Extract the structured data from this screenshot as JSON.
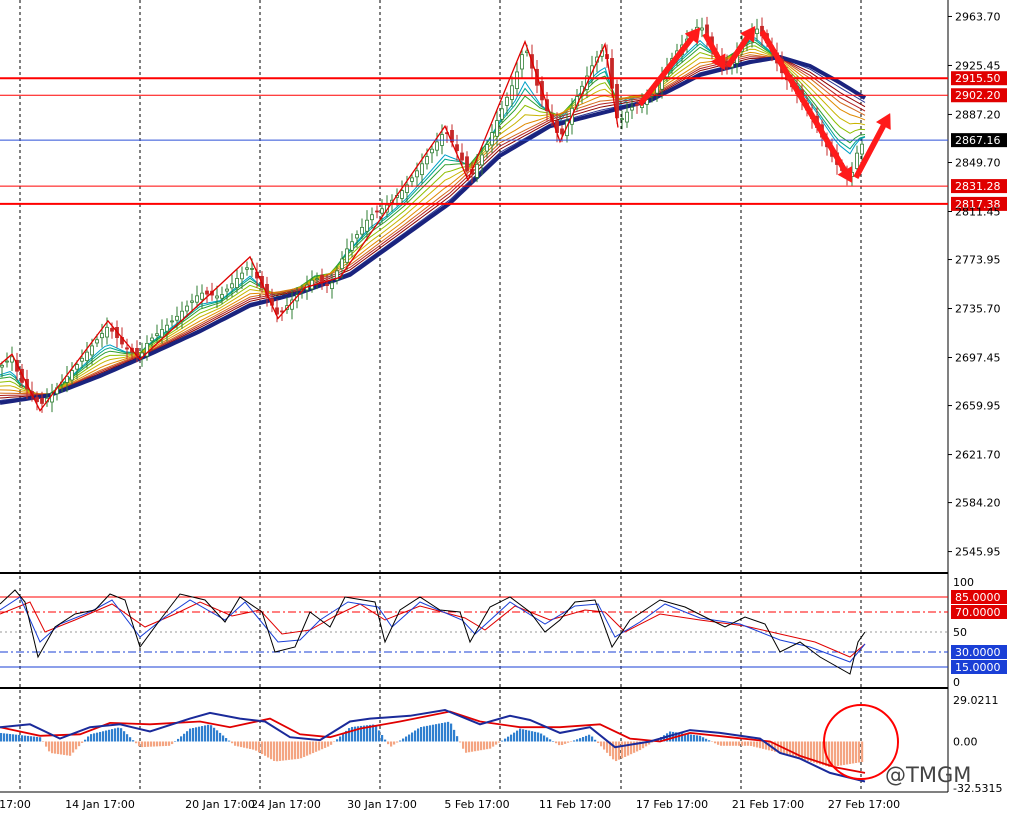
{
  "chart_data": {
    "type": "line",
    "main": {
      "y_ticks": [
        "2963.70",
        "2925.45",
        "2887.20",
        "2849.70",
        "2811.45",
        "2773.95",
        "2735.70",
        "2697.45",
        "2659.95",
        "2621.70",
        "2584.20",
        "2545.95"
      ],
      "ylim": [
        2530,
        2975
      ],
      "price_path": [
        [
          0,
          2690
        ],
        [
          12,
          2698
        ],
        [
          20,
          2680
        ],
        [
          40,
          2660
        ],
        [
          55,
          2672
        ],
        [
          75,
          2690
        ],
        [
          108,
          2722
        ],
        [
          125,
          2705
        ],
        [
          140,
          2698
        ],
        [
          148,
          2710
        ],
        [
          175,
          2728
        ],
        [
          200,
          2748
        ],
        [
          220,
          2745
        ],
        [
          250,
          2770
        ],
        [
          262,
          2752
        ],
        [
          278,
          2730
        ],
        [
          295,
          2745
        ],
        [
          315,
          2760
        ],
        [
          330,
          2752
        ],
        [
          345,
          2780
        ],
        [
          370,
          2808
        ],
        [
          385,
          2815
        ],
        [
          405,
          2830
        ],
        [
          425,
          2852
        ],
        [
          445,
          2875
        ],
        [
          460,
          2855
        ],
        [
          470,
          2838
        ],
        [
          485,
          2860
        ],
        [
          500,
          2888
        ],
        [
          515,
          2915
        ],
        [
          525,
          2942
        ],
        [
          540,
          2902
        ],
        [
          560,
          2868
        ],
        [
          575,
          2898
        ],
        [
          595,
          2930
        ],
        [
          605,
          2940
        ],
        [
          618,
          2880
        ],
        [
          630,
          2892
        ],
        [
          650,
          2900
        ],
        [
          675,
          2935
        ],
        [
          700,
          2958
        ],
        [
          712,
          2938
        ],
        [
          725,
          2922
        ],
        [
          745,
          2945
        ],
        [
          755,
          2956
        ],
        [
          770,
          2940
        ],
        [
          780,
          2922
        ],
        [
          800,
          2900
        ],
        [
          815,
          2880
        ],
        [
          835,
          2850
        ],
        [
          850,
          2836
        ],
        [
          858,
          2860
        ],
        [
          865,
          2867
        ]
      ],
      "ma_slow": [
        [
          0,
          2662
        ],
        [
          50,
          2668
        ],
        [
          100,
          2683
        ],
        [
          150,
          2700
        ],
        [
          200,
          2718
        ],
        [
          250,
          2738
        ],
        [
          300,
          2748
        ],
        [
          350,
          2762
        ],
        [
          400,
          2790
        ],
        [
          450,
          2818
        ],
        [
          500,
          2855
        ],
        [
          550,
          2878
        ],
        [
          600,
          2888
        ],
        [
          650,
          2898
        ],
        [
          700,
          2918
        ],
        [
          750,
          2928
        ],
        [
          780,
          2932
        ],
        [
          810,
          2925
        ],
        [
          840,
          2912
        ],
        [
          865,
          2900
        ]
      ],
      "ma_fast": [
        [
          0,
          2678
        ],
        [
          50,
          2670
        ],
        [
          100,
          2692
        ],
        [
          150,
          2706
        ],
        [
          200,
          2730
        ],
        [
          250,
          2752
        ],
        [
          300,
          2755
        ],
        [
          350,
          2778
        ],
        [
          400,
          2808
        ],
        [
          450,
          2840
        ],
        [
          500,
          2876
        ],
        [
          550,
          2892
        ],
        [
          600,
          2908
        ],
        [
          650,
          2905
        ],
        [
          700,
          2932
        ],
        [
          750,
          2940
        ],
        [
          780,
          2930
        ],
        [
          810,
          2905
        ],
        [
          840,
          2880
        ],
        [
          865,
          2872
        ]
      ],
      "zigzag": [
        [
          0,
          2692
        ],
        [
          12,
          2700
        ],
        [
          40,
          2656
        ],
        [
          108,
          2726
        ],
        [
          140,
          2696
        ],
        [
          250,
          2776
        ],
        [
          278,
          2728
        ],
        [
          305,
          2752
        ],
        [
          340,
          2760
        ],
        [
          445,
          2878
        ],
        [
          468,
          2836
        ],
        [
          525,
          2944
        ],
        [
          560,
          2866
        ],
        [
          605,
          2942
        ],
        [
          618,
          2877
        ]
      ],
      "arrows": [
        [
          [
            640,
            2895
          ],
          [
            700,
            2955
          ]
        ],
        [
          [
            705,
            2950
          ],
          [
            725,
            2922
          ]
        ],
        [
          [
            728,
            2925
          ],
          [
            755,
            2956
          ]
        ],
        [
          [
            762,
            2952
          ],
          [
            852,
            2834
          ]
        ],
        [
          [
            856,
            2838
          ],
          [
            890,
            2888
          ]
        ]
      ],
      "levels": [
        {
          "label": "2915.50",
          "value": 2915.5,
          "color": "#ff0000",
          "thick": true
        },
        {
          "label": "2902.20",
          "value": 2902.2,
          "color": "#ff0000",
          "thick": false
        },
        {
          "label": "2867.16",
          "value": 2867.16,
          "color": "#2b4fd6",
          "thick": false,
          "current": true
        },
        {
          "label": "2831.28",
          "value": 2831.28,
          "color": "#ff0000",
          "thick": false
        },
        {
          "label": "2817.38",
          "value": 2817.38,
          "color": "#ff0000",
          "thick": true
        }
      ]
    },
    "stoch": {
      "ylim": [
        0,
        100
      ],
      "y_ticks": [
        "100",
        "50",
        "0"
      ],
      "levels": [
        {
          "label": "85.0000",
          "value": 85,
          "color": "#ff0000",
          "style": "solid"
        },
        {
          "label": "70.0000",
          "value": 70,
          "color": "#ff0000",
          "style": "dashdot"
        },
        {
          "label": "30.0000",
          "value": 30,
          "color": "#1a3fd6",
          "style": "dashdot"
        },
        {
          "label": "15.0000",
          "value": 15,
          "color": "#1a3fd6",
          "style": "solid"
        }
      ],
      "black": [
        [
          0,
          78
        ],
        [
          15,
          92
        ],
        [
          25,
          80
        ],
        [
          38,
          25
        ],
        [
          55,
          55
        ],
        [
          75,
          68
        ],
        [
          95,
          72
        ],
        [
          110,
          88
        ],
        [
          125,
          82
        ],
        [
          140,
          35
        ],
        [
          160,
          62
        ],
        [
          180,
          88
        ],
        [
          205,
          82
        ],
        [
          225,
          60
        ],
        [
          240,
          85
        ],
        [
          262,
          70
        ],
        [
          275,
          30
        ],
        [
          295,
          35
        ],
        [
          310,
          70
        ],
        [
          330,
          55
        ],
        [
          345,
          85
        ],
        [
          375,
          80
        ],
        [
          385,
          40
        ],
        [
          400,
          72
        ],
        [
          420,
          85
        ],
        [
          440,
          72
        ],
        [
          460,
          70
        ],
        [
          470,
          40
        ],
        [
          490,
          75
        ],
        [
          510,
          85
        ],
        [
          530,
          70
        ],
        [
          545,
          50
        ],
        [
          560,
          62
        ],
        [
          575,
          80
        ],
        [
          595,
          82
        ],
        [
          612,
          35
        ],
        [
          630,
          62
        ],
        [
          660,
          82
        ],
        [
          685,
          75
        ],
        [
          705,
          65
        ],
        [
          725,
          55
        ],
        [
          745,
          65
        ],
        [
          765,
          58
        ],
        [
          780,
          30
        ],
        [
          800,
          40
        ],
        [
          820,
          25
        ],
        [
          850,
          8
        ],
        [
          858,
          40
        ],
        [
          865,
          50
        ]
      ],
      "blue": [
        [
          0,
          72
        ],
        [
          20,
          85
        ],
        [
          40,
          40
        ],
        [
          60,
          58
        ],
        [
          90,
          70
        ],
        [
          112,
          82
        ],
        [
          140,
          45
        ],
        [
          165,
          65
        ],
        [
          190,
          82
        ],
        [
          225,
          62
        ],
        [
          245,
          80
        ],
        [
          278,
          40
        ],
        [
          300,
          42
        ],
        [
          320,
          62
        ],
        [
          348,
          80
        ],
        [
          378,
          75
        ],
        [
          392,
          55
        ],
        [
          420,
          80
        ],
        [
          462,
          62
        ],
        [
          475,
          48
        ],
        [
          510,
          80
        ],
        [
          545,
          58
        ],
        [
          575,
          76
        ],
        [
          598,
          78
        ],
        [
          615,
          45
        ],
        [
          640,
          60
        ],
        [
          665,
          78
        ],
        [
          700,
          64
        ],
        [
          740,
          58
        ],
        [
          780,
          42
        ],
        [
          810,
          35
        ],
        [
          850,
          20
        ],
        [
          865,
          38
        ]
      ],
      "red": [
        [
          0,
          68
        ],
        [
          30,
          80
        ],
        [
          45,
          50
        ],
        [
          75,
          62
        ],
        [
          112,
          78
        ],
        [
          145,
          55
        ],
        [
          175,
          68
        ],
        [
          200,
          80
        ],
        [
          232,
          66
        ],
        [
          260,
          72
        ],
        [
          282,
          48
        ],
        [
          310,
          52
        ],
        [
          335,
          66
        ],
        [
          360,
          78
        ],
        [
          385,
          62
        ],
        [
          420,
          76
        ],
        [
          465,
          64
        ],
        [
          485,
          52
        ],
        [
          515,
          76
        ],
        [
          550,
          62
        ],
        [
          585,
          72
        ],
        [
          605,
          70
        ],
        [
          625,
          50
        ],
        [
          660,
          68
        ],
        [
          700,
          62
        ],
        [
          745,
          56
        ],
        [
          780,
          48
        ],
        [
          815,
          40
        ],
        [
          850,
          25
        ],
        [
          865,
          38
        ]
      ]
    },
    "macd": {
      "ylim": [
        -32.5315,
        29.0211
      ],
      "y_ticks": [
        "29.0211",
        "0.00",
        "-32.5315"
      ],
      "hist": [
        [
          0,
          6
        ],
        [
          40,
          3
        ],
        [
          50,
          -8
        ],
        [
          70,
          -10
        ],
        [
          90,
          5
        ],
        [
          120,
          10
        ],
        [
          140,
          -4
        ],
        [
          170,
          -3
        ],
        [
          190,
          9
        ],
        [
          210,
          12
        ],
        [
          235,
          -3
        ],
        [
          255,
          -6
        ],
        [
          275,
          -14
        ],
        [
          300,
          -12
        ],
        [
          330,
          -3
        ],
        [
          350,
          10
        ],
        [
          375,
          12
        ],
        [
          390,
          -4
        ],
        [
          420,
          10
        ],
        [
          450,
          14
        ],
        [
          465,
          -8
        ],
        [
          490,
          -5
        ],
        [
          520,
          9
        ],
        [
          540,
          6
        ],
        [
          560,
          -3
        ],
        [
          590,
          5
        ],
        [
          615,
          -14
        ],
        [
          640,
          -6
        ],
        [
          670,
          7
        ],
        [
          700,
          4
        ],
        [
          720,
          -3
        ],
        [
          750,
          -3
        ],
        [
          780,
          -8
        ],
        [
          800,
          -12
        ],
        [
          830,
          -18
        ],
        [
          865,
          -14
        ]
      ],
      "signal_red": [
        [
          0,
          10
        ],
        [
          40,
          4
        ],
        [
          80,
          5
        ],
        [
          110,
          13
        ],
        [
          150,
          12
        ],
        [
          200,
          14
        ],
        [
          230,
          10
        ],
        [
          270,
          16
        ],
        [
          300,
          5
        ],
        [
          330,
          3
        ],
        [
          360,
          9
        ],
        [
          400,
          14
        ],
        [
          450,
          21
        ],
        [
          480,
          14
        ],
        [
          520,
          10
        ],
        [
          560,
          10
        ],
        [
          600,
          12
        ],
        [
          630,
          2
        ],
        [
          660,
          0
        ],
        [
          690,
          6
        ],
        [
          730,
          3
        ],
        [
          770,
          0
        ],
        [
          800,
          -10
        ],
        [
          835,
          -18
        ],
        [
          865,
          -22
        ]
      ],
      "macd_blue": [
        [
          0,
          10
        ],
        [
          30,
          12
        ],
        [
          60,
          2
        ],
        [
          90,
          10
        ],
        [
          120,
          12
        ],
        [
          150,
          7
        ],
        [
          190,
          16
        ],
        [
          210,
          20
        ],
        [
          240,
          16
        ],
        [
          265,
          14
        ],
        [
          290,
          3
        ],
        [
          320,
          1
        ],
        [
          350,
          14
        ],
        [
          370,
          16
        ],
        [
          410,
          18
        ],
        [
          445,
          22
        ],
        [
          480,
          12
        ],
        [
          510,
          18
        ],
        [
          530,
          15
        ],
        [
          560,
          6
        ],
        [
          590,
          10
        ],
        [
          615,
          -4
        ],
        [
          650,
          0
        ],
        [
          690,
          8
        ],
        [
          720,
          6
        ],
        [
          760,
          2
        ],
        [
          780,
          -8
        ],
        [
          800,
          -12
        ],
        [
          830,
          -22
        ],
        [
          865,
          -28
        ]
      ]
    },
    "x_ticks": [
      "17:00",
      "14 Jan 17:00",
      "20 Jan 17:00",
      "24 Jan 17:00",
      "30 Jan 17:00",
      "5 Feb 17:00",
      "11 Feb 17:00",
      "17 Feb 17:00",
      "21 Feb 17:00",
      "27 Feb 17:00"
    ]
  },
  "watermark": "@TMGM"
}
